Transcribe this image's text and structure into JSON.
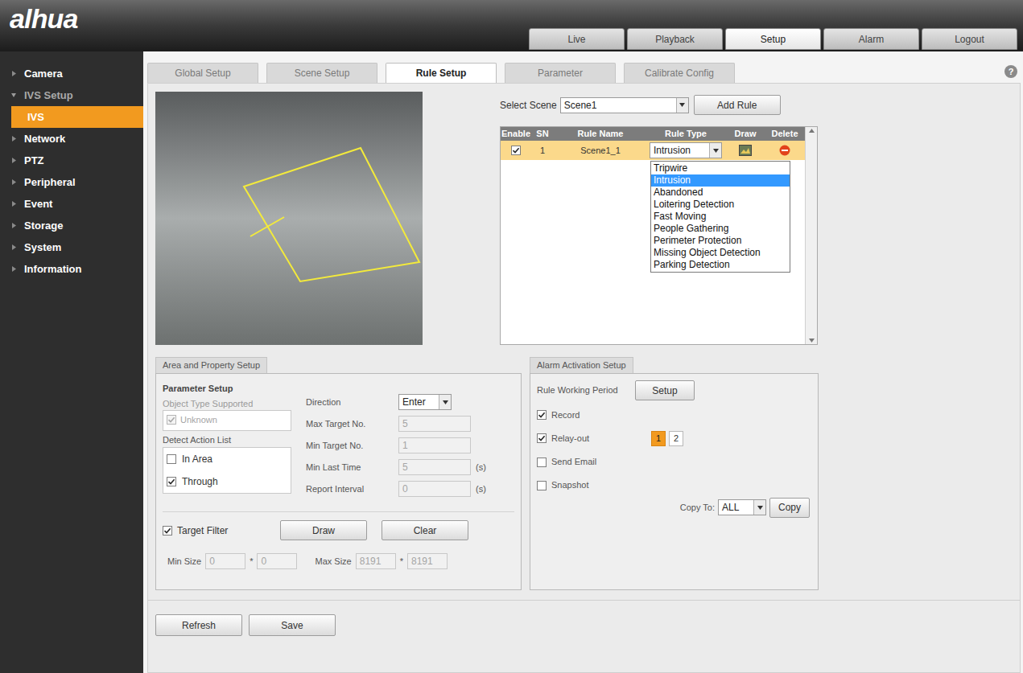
{
  "header": {
    "logo": "alhua",
    "nav": [
      {
        "label": "Live",
        "selected": false
      },
      {
        "label": "Playback",
        "selected": false
      },
      {
        "label": "Setup",
        "selected": true
      },
      {
        "label": "Alarm",
        "selected": false
      },
      {
        "label": "Logout",
        "selected": false
      }
    ]
  },
  "sidebar": {
    "items": [
      {
        "label": "Camera",
        "kind": "section",
        "expanded": false,
        "selected": false
      },
      {
        "label": "IVS Setup",
        "kind": "section",
        "expanded": true,
        "selected": false
      },
      {
        "label": "IVS",
        "kind": "child",
        "expanded": false,
        "selected": true
      },
      {
        "label": "Network",
        "kind": "section",
        "expanded": false,
        "selected": false
      },
      {
        "label": "PTZ",
        "kind": "section",
        "expanded": false,
        "selected": false
      },
      {
        "label": "Peripheral",
        "kind": "section",
        "expanded": false,
        "selected": false
      },
      {
        "label": "Event",
        "kind": "section",
        "expanded": false,
        "selected": false
      },
      {
        "label": "Storage",
        "kind": "section",
        "expanded": false,
        "selected": false
      },
      {
        "label": "System",
        "kind": "section",
        "expanded": false,
        "selected": false
      },
      {
        "label": "Information",
        "kind": "section",
        "expanded": false,
        "selected": false
      }
    ]
  },
  "subtabs": [
    {
      "label": "Global Setup",
      "selected": false
    },
    {
      "label": "Scene Setup",
      "selected": false
    },
    {
      "label": "Rule Setup",
      "selected": true
    },
    {
      "label": "Parameter",
      "selected": false
    },
    {
      "label": "Calibrate Config",
      "selected": false
    }
  ],
  "help": "?",
  "scene": {
    "label": "Select Scene",
    "value": "Scene1",
    "button": "Add Rule"
  },
  "rule_table": {
    "columns": [
      "Enable",
      "SN",
      "Rule Name",
      "Rule Type",
      "Draw",
      "Delete"
    ],
    "rows": [
      {
        "enabled": true,
        "sn": "1",
        "name": "Scene1_1",
        "type": "Intrusion",
        "selected": true
      }
    ],
    "type_menu": {
      "open": true,
      "options": [
        {
          "label": "Tripwire",
          "selected": false
        },
        {
          "label": "Intrusion",
          "selected": true
        },
        {
          "label": "Abandoned",
          "selected": false
        },
        {
          "label": "Loitering Detection",
          "selected": false
        },
        {
          "label": "Fast Moving",
          "selected": false
        },
        {
          "label": "People Gathering",
          "selected": false
        },
        {
          "label": "Perimeter Protection",
          "selected": false
        },
        {
          "label": "Missing Object Detection",
          "selected": false
        },
        {
          "label": "Parking Detection",
          "selected": false
        }
      ]
    }
  },
  "area_panel": {
    "tab": "Area and Property Setup",
    "heading": "Parameter Setup",
    "object_type": {
      "label": "Object Type Supported",
      "options": [
        {
          "label": "Unknown",
          "checked": true,
          "disabled": true
        }
      ]
    },
    "actions": {
      "label": "Detect Action List",
      "options": [
        {
          "label": "In Area",
          "checked": false,
          "disabled": false
        },
        {
          "label": "Through",
          "checked": true,
          "disabled": false
        }
      ]
    },
    "direction": {
      "label": "Direction",
      "value": "Enter"
    },
    "fields": [
      {
        "label": "Max Target No.",
        "value": "5",
        "disabled": true
      },
      {
        "label": "Min Target No.",
        "value": "1",
        "disabled": true
      },
      {
        "label": "Min Last Time",
        "value": "5",
        "unit": "(s)",
        "disabled": true
      },
      {
        "label": "Report Interval",
        "value": "0",
        "unit": "(s)",
        "disabled": true
      }
    ],
    "target_filter": {
      "label": "Target Filter",
      "checked": true,
      "buttons": [
        "Draw",
        "Clear"
      ]
    },
    "separator": "*",
    "sizes": [
      {
        "label": "Min Size",
        "width": "0",
        "height": "0",
        "disabled": true
      },
      {
        "label": "Max Size",
        "width": "8191",
        "height": "8191",
        "disabled": true
      }
    ]
  },
  "alarm_panel": {
    "tab": "Alarm Activation Setup",
    "period": {
      "label": "Rule Working Period",
      "button": "Setup"
    },
    "options": [
      {
        "label": "Record",
        "checked": true
      },
      {
        "label": "Relay-out",
        "checked": true,
        "relays": [
          {
            "label": "1",
            "selected": true
          },
          {
            "label": "2",
            "selected": false
          }
        ]
      },
      {
        "label": "Send Email",
        "checked": false
      },
      {
        "label": "Snapshot",
        "checked": false
      }
    ],
    "copy": {
      "label": "Copy To:",
      "value": "ALL",
      "button": "Copy"
    }
  },
  "footer": {
    "buttons": [
      "Refresh",
      "Save"
    ]
  }
}
